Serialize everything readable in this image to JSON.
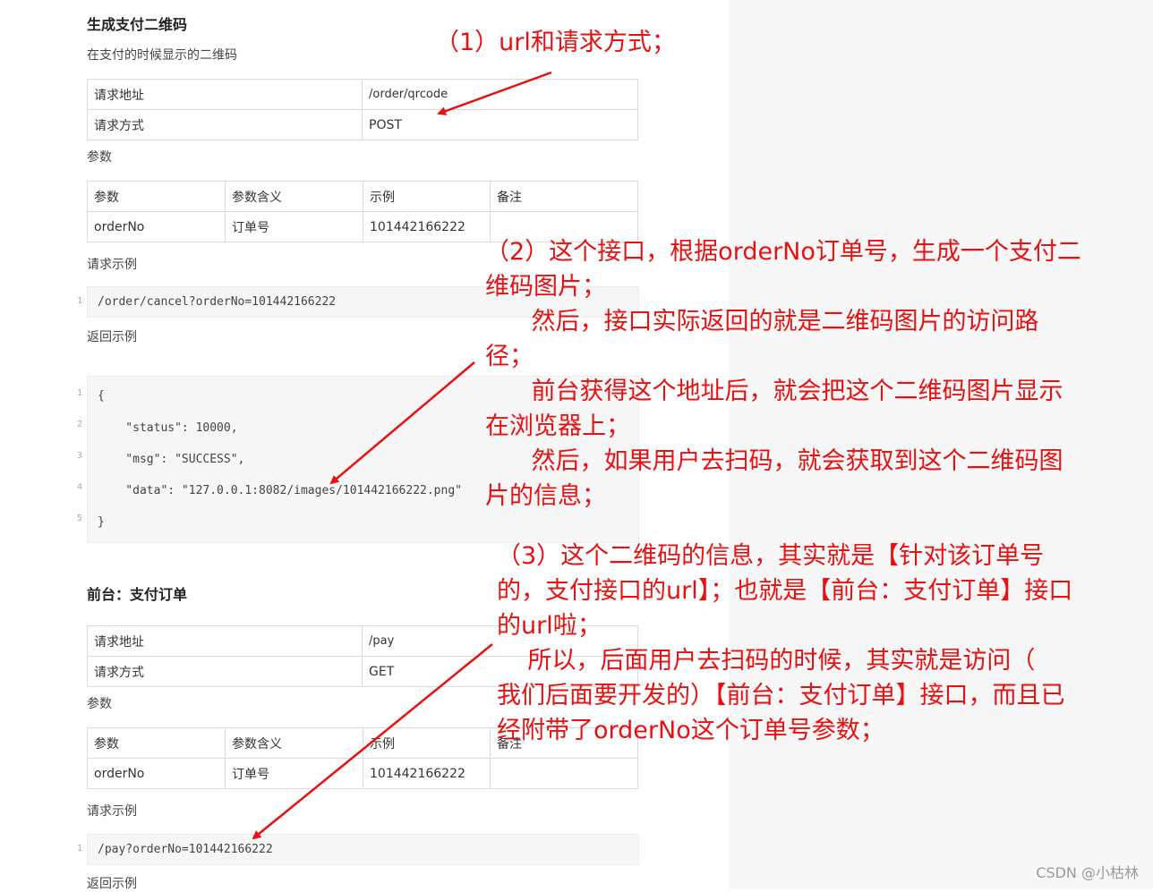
{
  "section1": {
    "title": "生成支付二维码",
    "desc": "在支付的时候显示的二维码",
    "info": [
      {
        "label": "请求地址",
        "value": "/order/qrcode"
      },
      {
        "label": "请求方式",
        "value": "POST"
      }
    ],
    "params_label": "参数",
    "param_headers": [
      "参数",
      "参数含义",
      "示例",
      "备注"
    ],
    "param_row": [
      "orderNo",
      "订单号",
      "101442166222",
      ""
    ],
    "req_example_label": "请求示例",
    "req_code": "/order/cancel?orderNo=101442166222",
    "resp_example_label": "返回示例",
    "resp_lines": [
      "{",
      "    \"status\": 10000,",
      "    \"msg\": \"SUCCESS\",",
      "    \"data\": \"127.0.0.1:8082/images/101442166222.png\"",
      "}"
    ]
  },
  "section2": {
    "title": "前台：支付订单",
    "info": [
      {
        "label": "请求地址",
        "value": "/pay"
      },
      {
        "label": "请求方式",
        "value": "GET"
      }
    ],
    "params_label": "参数",
    "param_headers": [
      "参数",
      "参数含义",
      "示例",
      "备注"
    ],
    "param_row": [
      "orderNo",
      "订单号",
      "101442166222",
      ""
    ],
    "req_example_label": "请求示例",
    "req_code": "/pay?orderNo=101442166222",
    "resp_example_label": "返回示例"
  },
  "annotations": {
    "note1": "（1）url和请求方式；",
    "note2_lines": [
      "（2）这个接口，根据orderNo订单号，生成一个支付二",
      "维码图片；",
      "      然后，接口实际返回的就是二维码图片的访问路",
      "径；",
      "      前台获得这个地址后，就会把这个二维码图片显示",
      "在浏览器上；",
      "      然后，如果用户去扫码，就会获取到这个二维码图",
      "片的信息；"
    ],
    "note3_lines": [
      "（3）这个二维码的信息，其实就是【针对该订单号",
      "的，支付接口的url】；也就是【前台：支付订单】接口",
      "的url啦；",
      "    所以，后面用户去扫码的时候，其实就是访问（",
      "我们后面要开发的）【前台：支付订单】接口，而且已",
      "经附带了orderNo这个订单号参数；"
    ],
    "color": "#e81010"
  },
  "watermark": "CSDN @小枯林"
}
